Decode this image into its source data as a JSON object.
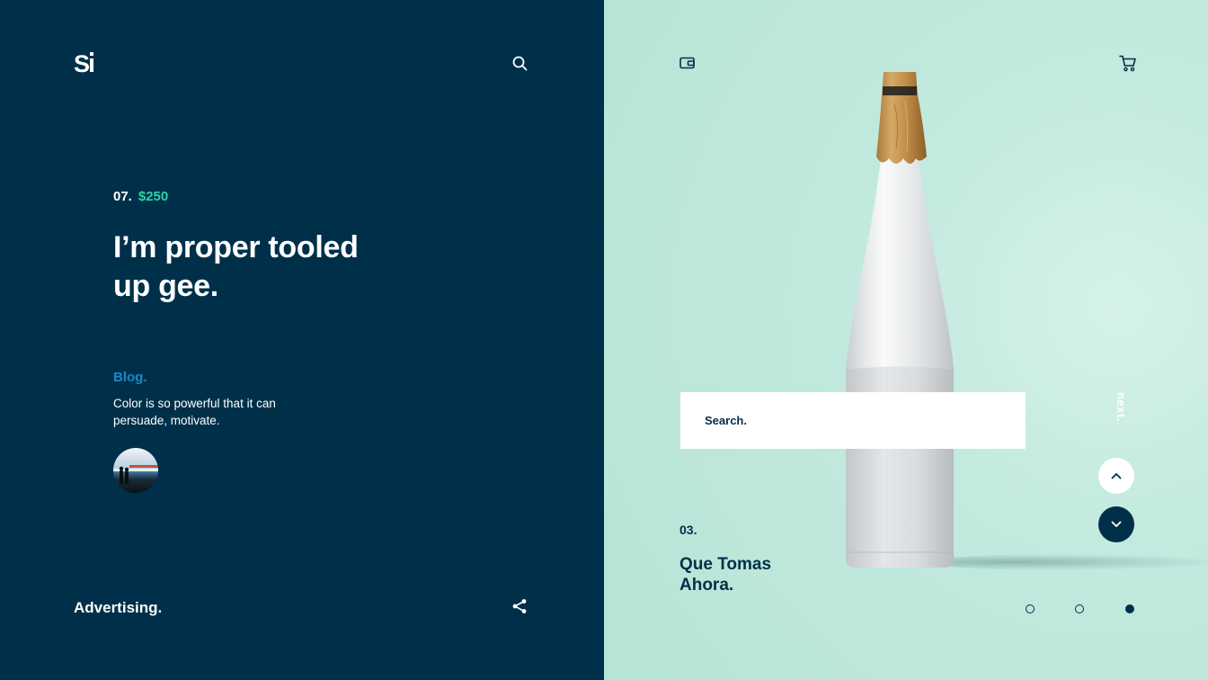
{
  "brand": {
    "logo_alt": "Si"
  },
  "hero": {
    "number": "07.",
    "price": "$250",
    "headline": "I’m proper tooled up gee."
  },
  "blog": {
    "label": "Blog.",
    "text": "Color is so powerful that it can persuade, motivate."
  },
  "footer": {
    "label": "Advertising."
  },
  "search": {
    "placeholder": "Search."
  },
  "slide": {
    "next_label": "next.",
    "number": "03.",
    "title": "Que Tomas Ahora."
  },
  "pagination": {
    "total": 3,
    "active": 3
  },
  "icons": {
    "search": "search-icon",
    "share": "share-icon",
    "wallet": "wallet-icon",
    "cart": "cart-icon",
    "up": "chevron-up-icon",
    "down": "chevron-down-icon"
  },
  "colors": {
    "dark": "#003049",
    "accent_green": "#2ed3a9",
    "accent_blue": "#1b87c4",
    "mint": "#c3eadf"
  }
}
